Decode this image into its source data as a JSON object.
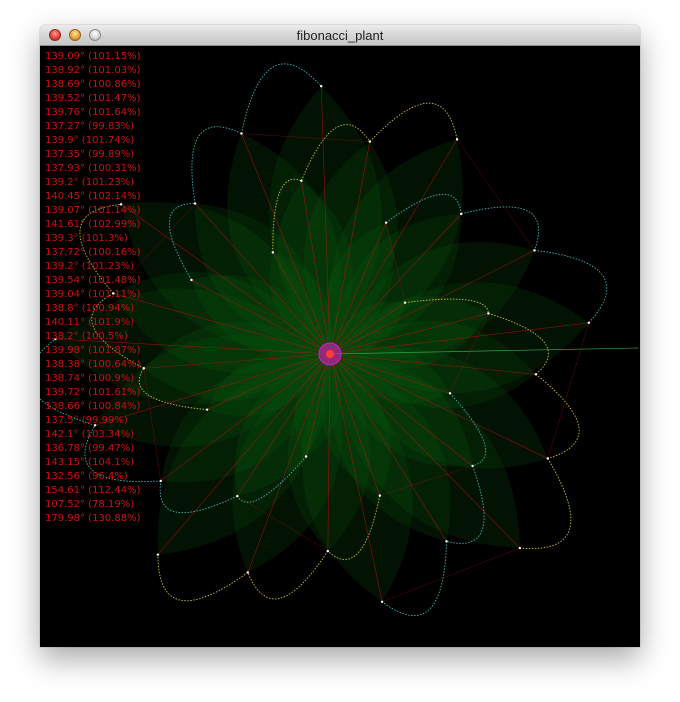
{
  "window": {
    "title": "fibonacci_plant"
  },
  "controls": {
    "close": "close-button",
    "minimize": "minimize-button",
    "zoom": "zoom-button"
  },
  "colors": {
    "background": "#000000",
    "petal_fill": "#0d6b10",
    "yellow_outline": "#e0d830",
    "cyan_outline": "#3ad0d0",
    "red_ray": "#c01010",
    "center": "#d020d0",
    "text": "#d01010"
  },
  "angles": [
    "139.09° (101.15%)",
    "138.92° (101.03%)",
    "138.69° (100.86%)",
    "139.52° (101.47%)",
    "139.76° (101.64%)",
    "137.27° (99.83%)",
    "139.9° (101.74%)",
    "137.35° (99.89%)",
    "137.93° (100.31%)",
    "139.2° (101.23%)",
    "140.45° (102.14%)",
    "139.07° (101.14%)",
    "141.61° (102.99%)",
    "139.3° (101.3%)",
    "137.72° (100.16%)",
    "139.2° (101.23%)",
    "139.54° (101.48%)",
    "139.04° (101.11%)",
    "138.8° (100.94%)",
    "140.11° (101.9%)",
    "138.2° (100.5%)",
    "139.98° (101.87%)",
    "138.38° (100.64%)",
    "138.74° (100.9%)",
    "139.72° (101.61%)",
    "138.66° (100.84%)",
    "137.5° (99.99%)",
    "142.1° (103.34%)",
    "136.78° (99.47%)",
    "143.15° (104.1%)",
    "132.56° (96.4%)",
    "154.61° (112.44%)",
    "107.52° (78.19%)",
    "179.98° (130.88%)"
  ]
}
